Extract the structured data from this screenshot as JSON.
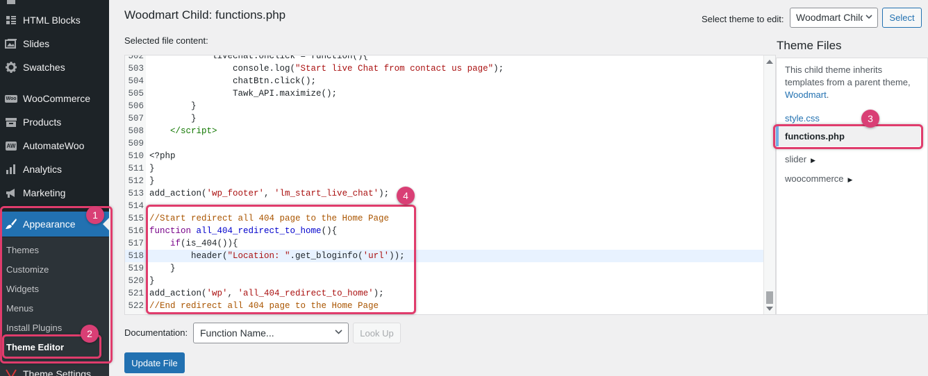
{
  "sidebar": {
    "items": [
      {
        "label": "HTML Blocks",
        "icon": "grid-icon"
      },
      {
        "label": "Slides",
        "icon": "slides-icon"
      },
      {
        "label": "Swatches",
        "icon": "gear-icon"
      },
      {
        "label": "WooCommerce",
        "icon": "woo-icon"
      },
      {
        "label": "Products",
        "icon": "archive-icon"
      },
      {
        "label": "AutomateWoo",
        "icon": "aw-icon"
      },
      {
        "label": "Analytics",
        "icon": "bar-chart-icon"
      },
      {
        "label": "Marketing",
        "icon": "megaphone-icon"
      },
      {
        "label": "Appearance",
        "icon": "paintbrush-icon"
      }
    ],
    "woo_icon_text": "Woo",
    "aw_icon_text": "AW",
    "submenu": [
      "Themes",
      "Customize",
      "Widgets",
      "Menus",
      "Install Plugins",
      "Theme Editor"
    ],
    "partial_bottom": "Theme Settings"
  },
  "header": {
    "title": "Woodmart Child: functions.php",
    "select_theme_label": "Select theme to edit:",
    "select_theme_value": "Woodmart Child",
    "select_button": "Select"
  },
  "editor": {
    "label": "Selected file content:",
    "line_numbers": [
      "502",
      "503",
      "504",
      "505",
      "506",
      "507",
      "508",
      "509",
      "510",
      "511",
      "512",
      "513",
      "514",
      "515",
      "516",
      "517",
      "518",
      "519",
      "520",
      "521",
      "522"
    ],
    "partial_top_line": "livechat.onclick = function(){"
  },
  "theme_files": {
    "title": "Theme Files",
    "note": "This child theme inherits templates from a parent theme,",
    "parent_link": "Woodmart",
    "files": [
      "style.css",
      "functions.php"
    ],
    "folders": [
      "slider",
      "woocommerce"
    ]
  },
  "documentation": {
    "label": "Documentation:",
    "placeholder": "Function Name...",
    "lookup": "Look Up"
  },
  "update_button": "Update File",
  "badges": [
    "1",
    "2",
    "3",
    "4"
  ],
  "colors": {
    "accent": "#2271b1",
    "sidebar_bg": "#1d2327",
    "highlight": "#e03c6c"
  }
}
